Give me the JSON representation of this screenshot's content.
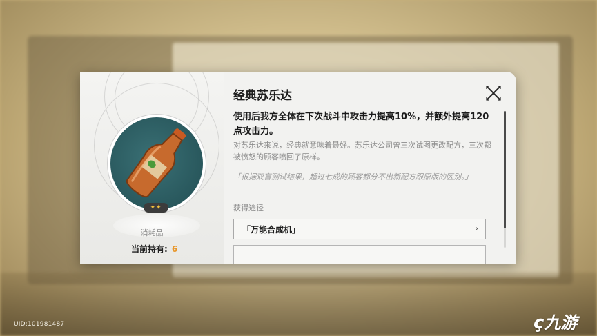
{
  "item": {
    "name": "经典苏乐达",
    "rarity_stars": "✦✦",
    "category": "消耗品",
    "owned_label": "当前持有:",
    "owned_count": "6",
    "effect": "使用后我方全体在下次战斗中攻击力提高10%，并额外提高120点攻击力。",
    "lore": "对苏乐达来说，经典就意味着最好。苏乐达公司曾三次试图更改配方，三次都被愤怒的顾客喷回了原样。",
    "quote": "「根据双盲测试结果，超过七成的顾客都分不出新配方跟原版的区别。」",
    "sources_heading": "获得途径",
    "sources": [
      {
        "label": "「万能合成机」",
        "chevron": "›"
      }
    ]
  },
  "footer": {
    "uid": "UID:101981487",
    "watermark": "九游"
  },
  "colors": {
    "accent": "#e8962a",
    "circle": "#2b5c61"
  }
}
